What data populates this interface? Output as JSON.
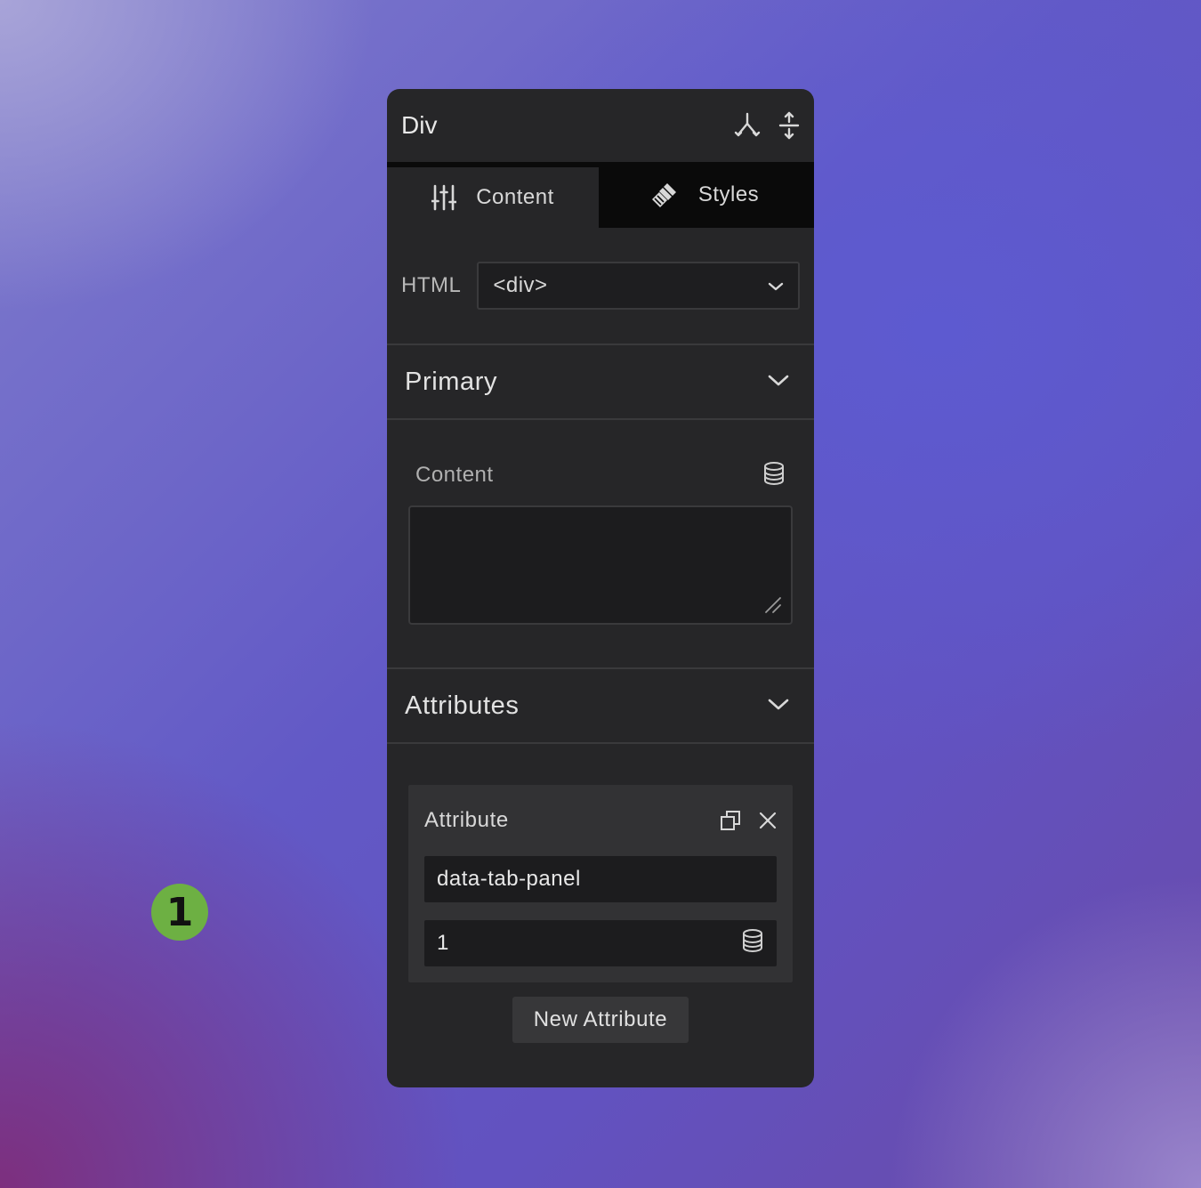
{
  "badge": {
    "number": "1"
  },
  "panel": {
    "title": "Div",
    "header_icons": [
      "structure-icon",
      "expand-vertical-icon"
    ]
  },
  "tabs": [
    {
      "label": "Content",
      "icon": "sliders-icon",
      "active": true
    },
    {
      "label": "Styles",
      "icon": "paintbrush-icon",
      "active": false
    }
  ],
  "html_tag": {
    "label": "HTML",
    "value": "<div>"
  },
  "primary": {
    "title": "Primary",
    "content_label": "Content",
    "content_value": ""
  },
  "attributes": {
    "title": "Attributes",
    "card": {
      "title": "Attribute",
      "name": "data-tab-panel",
      "value": "1"
    },
    "new_button": "New Attribute"
  },
  "colors": {
    "badge": "#6db043",
    "panel_bg": "#262628",
    "tab_bar_bg": "#0a0a0a",
    "input_bg": "#1c1c1e"
  }
}
